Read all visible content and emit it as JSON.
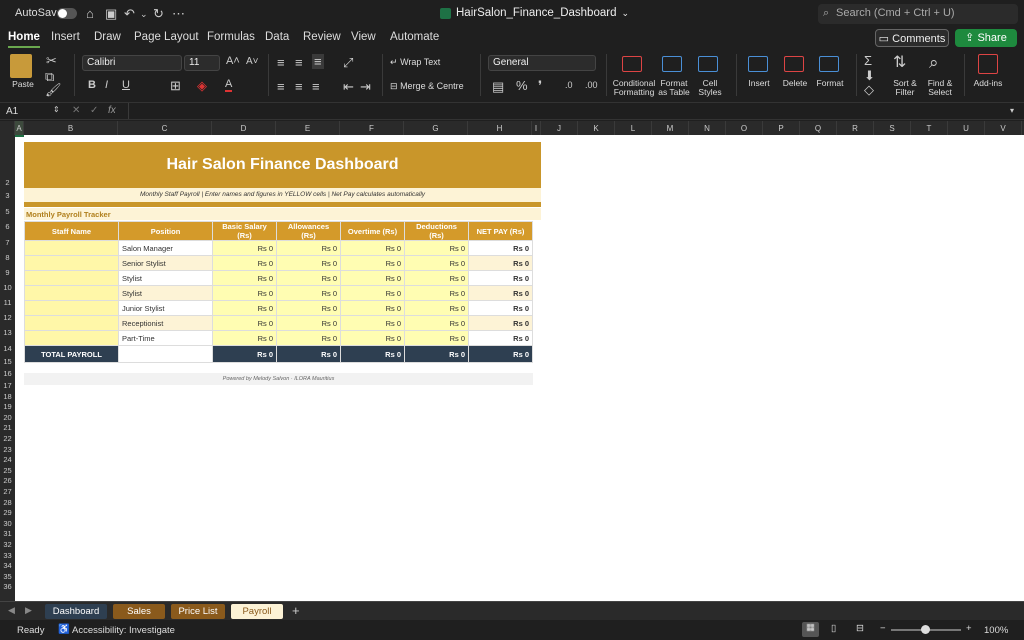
{
  "titlebar": {
    "autosave_label": "AutoSave",
    "doc_title": "HairSalon_Finance_Dashboard",
    "search_placeholder": "Search (Cmd + Ctrl + U)"
  },
  "menu_tabs": [
    "Home",
    "Insert",
    "Draw",
    "Page Layout",
    "Formulas",
    "Data",
    "Review",
    "View",
    "Automate"
  ],
  "actions": {
    "comments": "Comments",
    "share": "Share"
  },
  "ribbon": {
    "paste": "Paste",
    "font_name": "Calibri",
    "font_size": "11",
    "wrap_text": "Wrap Text",
    "merge_centre": "Merge & Centre",
    "number_format": "General",
    "conditional_formatting": "Conditional\nFormatting",
    "format_as_table": "Format\nas Table",
    "cell_styles": "Cell\nStyles",
    "insert": "Insert",
    "delete": "Delete",
    "format": "Format",
    "sort_filter": "Sort &\nFilter",
    "find_select": "Find &\nSelect",
    "add_ins": "Add-ins"
  },
  "formula_bar": {
    "name_box": "A1",
    "fx": "fx"
  },
  "columns": [
    "A",
    "B",
    "C",
    "D",
    "E",
    "F",
    "G",
    "H",
    "I",
    "J",
    "K",
    "L",
    "M",
    "N",
    "O",
    "P",
    "Q",
    "R",
    "S",
    "T",
    "U",
    "V"
  ],
  "rows": [
    "1",
    "2",
    "3",
    "4",
    "5",
    "6",
    "7",
    "8",
    "9",
    "10",
    "11",
    "12",
    "13",
    "14",
    "15",
    "16",
    "17",
    "18",
    "19",
    "20",
    "21",
    "22",
    "23",
    "24",
    "25",
    "26",
    "27",
    "28",
    "29",
    "30",
    "31",
    "32",
    "33",
    "34",
    "35",
    "36"
  ],
  "sheet": {
    "title": "Hair Salon Finance Dashboard",
    "subtitle": "Monthly Staff Payroll  |  Enter names and figures in YELLOW cells  |  Net Pay calculates automatically",
    "section": "Monthly Payroll Tracker",
    "headers": [
      "Staff Name",
      "Position",
      "Basic Salary (Rs)",
      "Allowances (Rs)",
      "Overtime (Rs)",
      "Deductions (Rs)",
      "NET PAY (Rs)"
    ],
    "rows": [
      {
        "name": "",
        "position": "Salon Manager",
        "basic": "Rs 0",
        "allow": "Rs 0",
        "ot": "Rs 0",
        "ded": "Rs 0",
        "net": "Rs 0"
      },
      {
        "name": "",
        "position": "Senior Stylist",
        "basic": "Rs 0",
        "allow": "Rs 0",
        "ot": "Rs 0",
        "ded": "Rs 0",
        "net": "Rs 0"
      },
      {
        "name": "",
        "position": "Stylist",
        "basic": "Rs 0",
        "allow": "Rs 0",
        "ot": "Rs 0",
        "ded": "Rs 0",
        "net": "Rs 0"
      },
      {
        "name": "",
        "position": "Stylist",
        "basic": "Rs 0",
        "allow": "Rs 0",
        "ot": "Rs 0",
        "ded": "Rs 0",
        "net": "Rs 0"
      },
      {
        "name": "",
        "position": "Junior Stylist",
        "basic": "Rs 0",
        "allow": "Rs 0",
        "ot": "Rs 0",
        "ded": "Rs 0",
        "net": "Rs 0"
      },
      {
        "name": "",
        "position": "Receptionist",
        "basic": "Rs 0",
        "allow": "Rs 0",
        "ot": "Rs 0",
        "ded": "Rs 0",
        "net": "Rs 0"
      },
      {
        "name": "",
        "position": "Part-Time",
        "basic": "Rs 0",
        "allow": "Rs 0",
        "ot": "Rs 0",
        "ded": "Rs 0",
        "net": "Rs 0"
      }
    ],
    "total": {
      "label": "TOTAL PAYROLL",
      "basic": "Rs 0",
      "allow": "Rs 0",
      "ot": "Rs 0",
      "ded": "Rs 0",
      "net": "Rs 0"
    },
    "footer": "Powered by Melody Salvon  ·  ILORA Mauritius"
  },
  "sheet_tabs": [
    {
      "label": "Dashboard",
      "bg": "#2e3f51",
      "fg": "#ffffff"
    },
    {
      "label": "Sales",
      "bg": "#8a5a1c",
      "fg": "#ffffff"
    },
    {
      "label": "Price List",
      "bg": "#8a5a1c",
      "fg": "#ffffff"
    },
    {
      "label": "Payroll",
      "bg": "#fdf3d6",
      "fg": "#8a5a1c"
    }
  ],
  "status": {
    "ready": "Ready",
    "accessibility": "Accessibility: Investigate",
    "zoom": "100%"
  }
}
